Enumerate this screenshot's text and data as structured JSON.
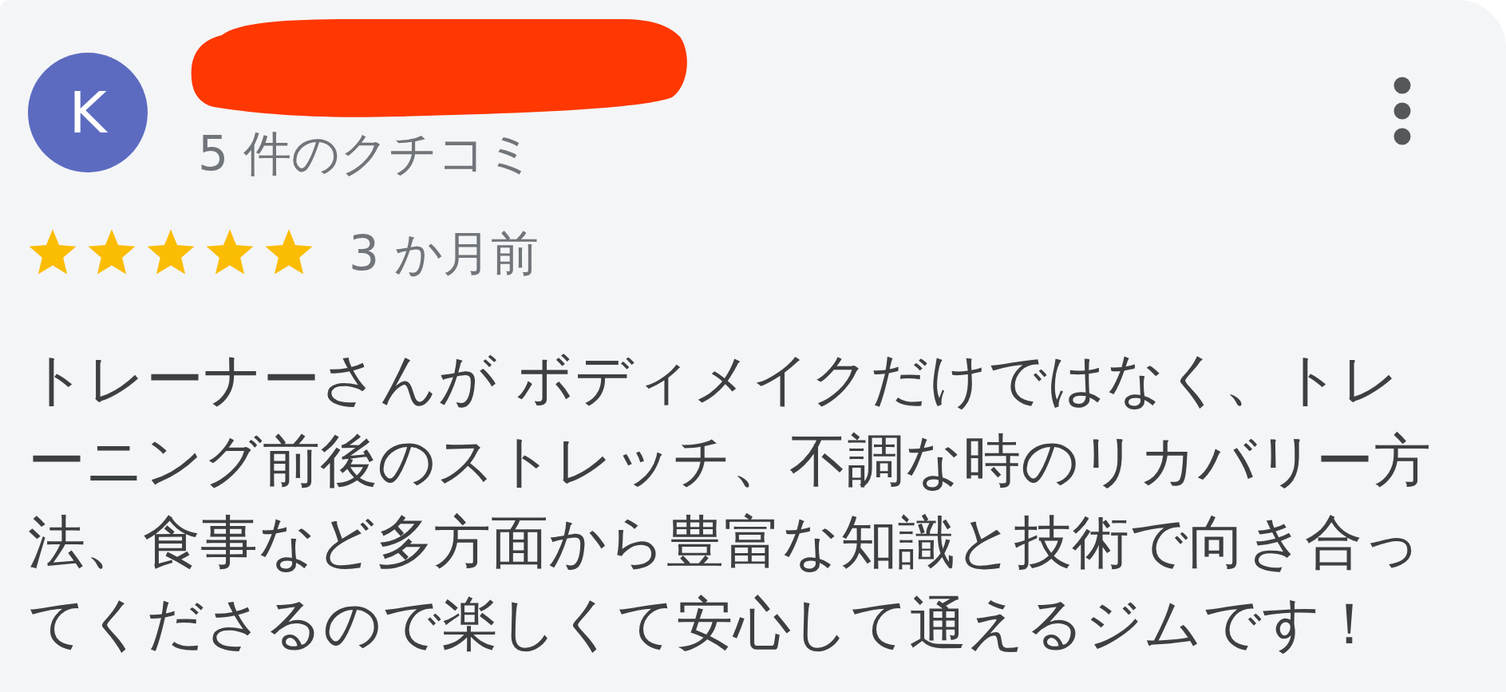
{
  "review": {
    "avatar_letter": "K",
    "review_count": "5 件のクチコミ",
    "stars": 5,
    "time": "3 か月前",
    "text": "トレーナーさんが ボディメイクだけではなく、トレーニング前後のストレッチ、不調な時のリカバリー方法、食事など多方面から豊富な知識と技術で向き合ってくださるので楽しくて安心して通えるジムです！"
  }
}
